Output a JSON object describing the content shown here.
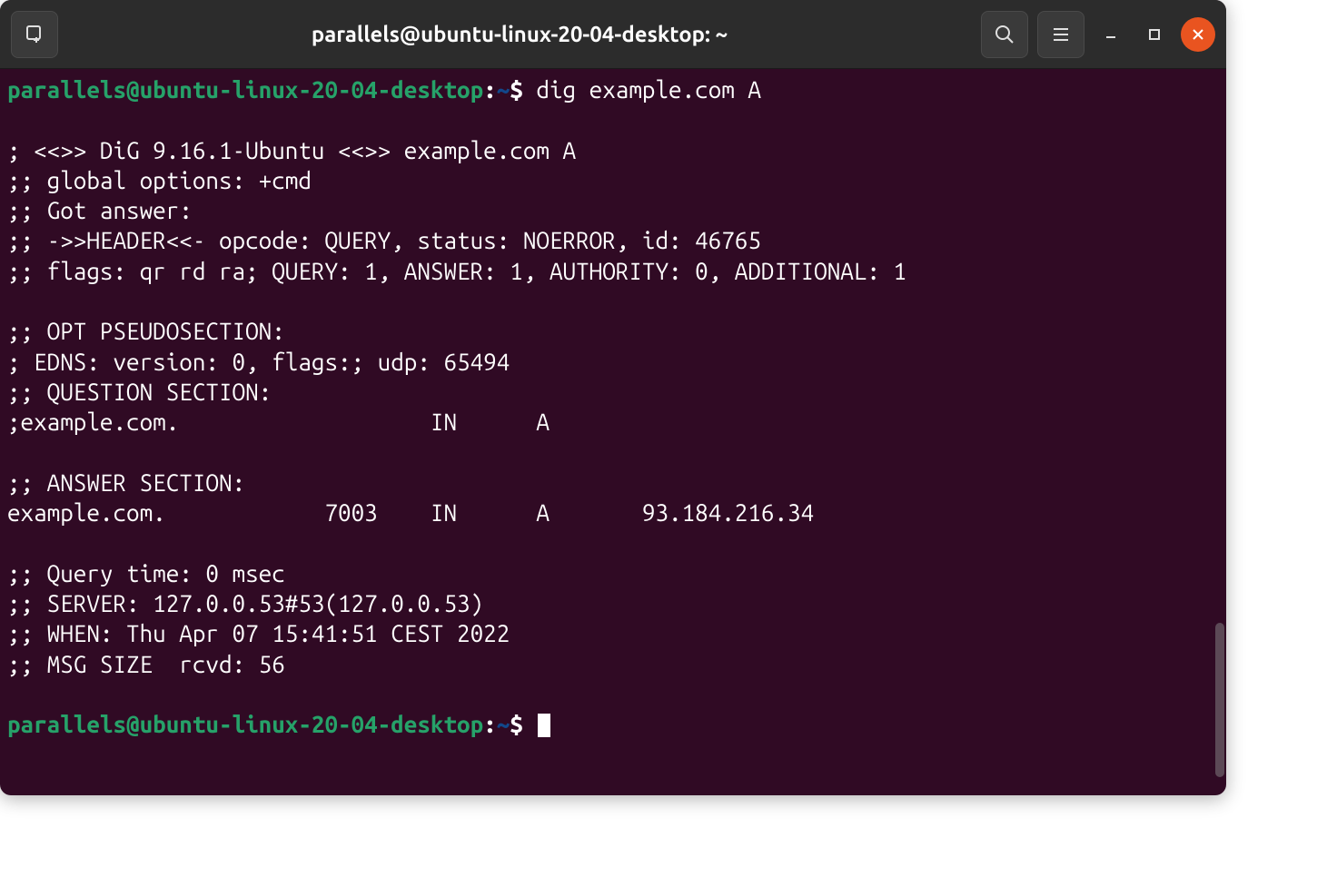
{
  "titlebar": {
    "title": "parallels@ubuntu-linux-20-04-desktop: ~"
  },
  "prompt": {
    "user_host": "parallels@ubuntu-linux-20-04-desktop",
    "colon": ":",
    "path": "~",
    "dollar": "$"
  },
  "command": "dig example.com A",
  "output": {
    "l1": "",
    "l2": "; <<>> DiG 9.16.1-Ubuntu <<>> example.com A",
    "l3": ";; global options: +cmd",
    "l4": ";; Got answer:",
    "l5": ";; ->>HEADER<<- opcode: QUERY, status: NOERROR, id: 46765",
    "l6": ";; flags: qr rd ra; QUERY: 1, ANSWER: 1, AUTHORITY: 0, ADDITIONAL: 1",
    "l7": "",
    "l8": ";; OPT PSEUDOSECTION:",
    "l9": "; EDNS: version: 0, flags:; udp: 65494",
    "l10": ";; QUESTION SECTION:",
    "l11": ";example.com.\t\t\tIN\tA",
    "l12": "",
    "l13": ";; ANSWER SECTION:",
    "l14": "example.com.\t\t7003\tIN\tA\t93.184.216.34",
    "l15": "",
    "l16": ";; Query time: 0 msec",
    "l17": ";; SERVER: 127.0.0.53#53(127.0.0.53)",
    "l18": ";; WHEN: Thu Apr 07 15:41:51 CEST 2022",
    "l19": ";; MSG SIZE  rcvd: 56",
    "l20": ""
  }
}
